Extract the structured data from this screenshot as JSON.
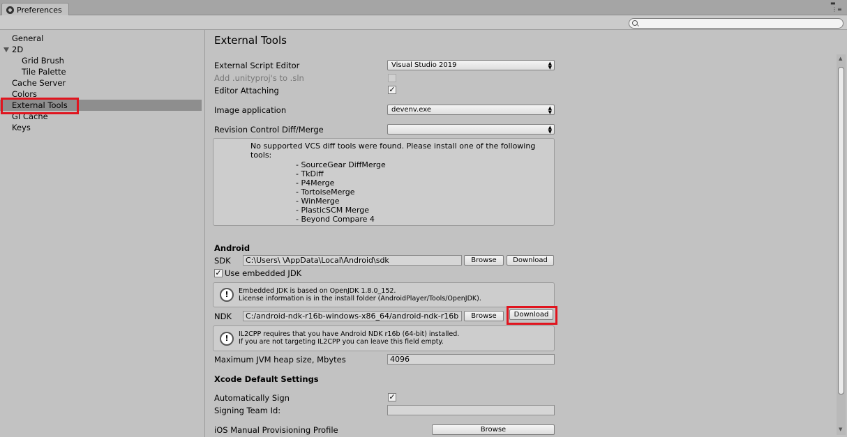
{
  "window": {
    "tab_title": "Preferences",
    "controls": [
      "▬",
      "⋮≡"
    ]
  },
  "search": {
    "placeholder": ""
  },
  "sidebar": {
    "items": [
      {
        "label": "General",
        "indent": 0
      },
      {
        "label": "2D",
        "indent": 0,
        "expanded": true
      },
      {
        "label": "Grid Brush",
        "indent": 1
      },
      {
        "label": "Tile Palette",
        "indent": 1
      },
      {
        "label": "Cache Server",
        "indent": 0
      },
      {
        "label": "Colors",
        "indent": 0
      },
      {
        "label": "External Tools",
        "indent": 0,
        "selected": true
      },
      {
        "label": "GI Cache",
        "indent": 0
      },
      {
        "label": "Keys",
        "indent": 0
      }
    ]
  },
  "main": {
    "title": "External Tools",
    "external_script_editor": {
      "label": "External Script Editor",
      "value": "Visual Studio 2019"
    },
    "add_unityproj": {
      "label": "Add .unityproj's to .sln",
      "checked": false,
      "disabled": true
    },
    "editor_attaching": {
      "label": "Editor Attaching",
      "checked": true
    },
    "image_application": {
      "label": "Image application",
      "value": "devenv.exe"
    },
    "revision_control": {
      "label": "Revision Control Diff/Merge",
      "value": ""
    },
    "vcs_message": "No supported VCS diff tools were found. Please install one of the following tools:",
    "vcs_tools": [
      "- SourceGear DiffMerge",
      "- TkDiff",
      "- P4Merge",
      "- TortoiseMerge",
      "- WinMerge",
      "- PlasticSCM Merge",
      "- Beyond Compare 4"
    ],
    "android": {
      "section_title": "Android",
      "sdk_label": "SDK",
      "sdk_path": "C:\\Users\\          \\AppData\\Local\\Android\\sdk",
      "browse": "Browse",
      "download": "Download",
      "use_embedded_jdk": {
        "label": "Use embedded JDK",
        "checked": true
      },
      "jdk_info_1": "Embedded JDK is based on OpenJDK 1.8.0_152.",
      "jdk_info_2": "License information is in the install folder (AndroidPlayer/Tools/OpenJDK).",
      "ndk_label": "NDK",
      "ndk_path": "C:/android-ndk-r16b-windows-x86_64/android-ndk-r16b",
      "ndk_info_1": "IL2CPP requires that you have Android NDK r16b (64-bit) installed.",
      "ndk_info_2": "If you are not targeting IL2CPP you can leave this field empty.",
      "jvm_heap": {
        "label": "Maximum JVM heap size, Mbytes",
        "value": "4096"
      }
    },
    "xcode": {
      "section_title": "Xcode Default Settings",
      "auto_sign": {
        "label": "Automatically Sign",
        "checked": true
      },
      "team_id": {
        "label": "Signing Team Id:",
        "value": ""
      },
      "ios_profile": {
        "label": "iOS Manual Provisioning Profile",
        "button": "Browse"
      }
    }
  },
  "colors": {
    "highlight": "#e0141e",
    "selected": "#8e8e8e"
  }
}
